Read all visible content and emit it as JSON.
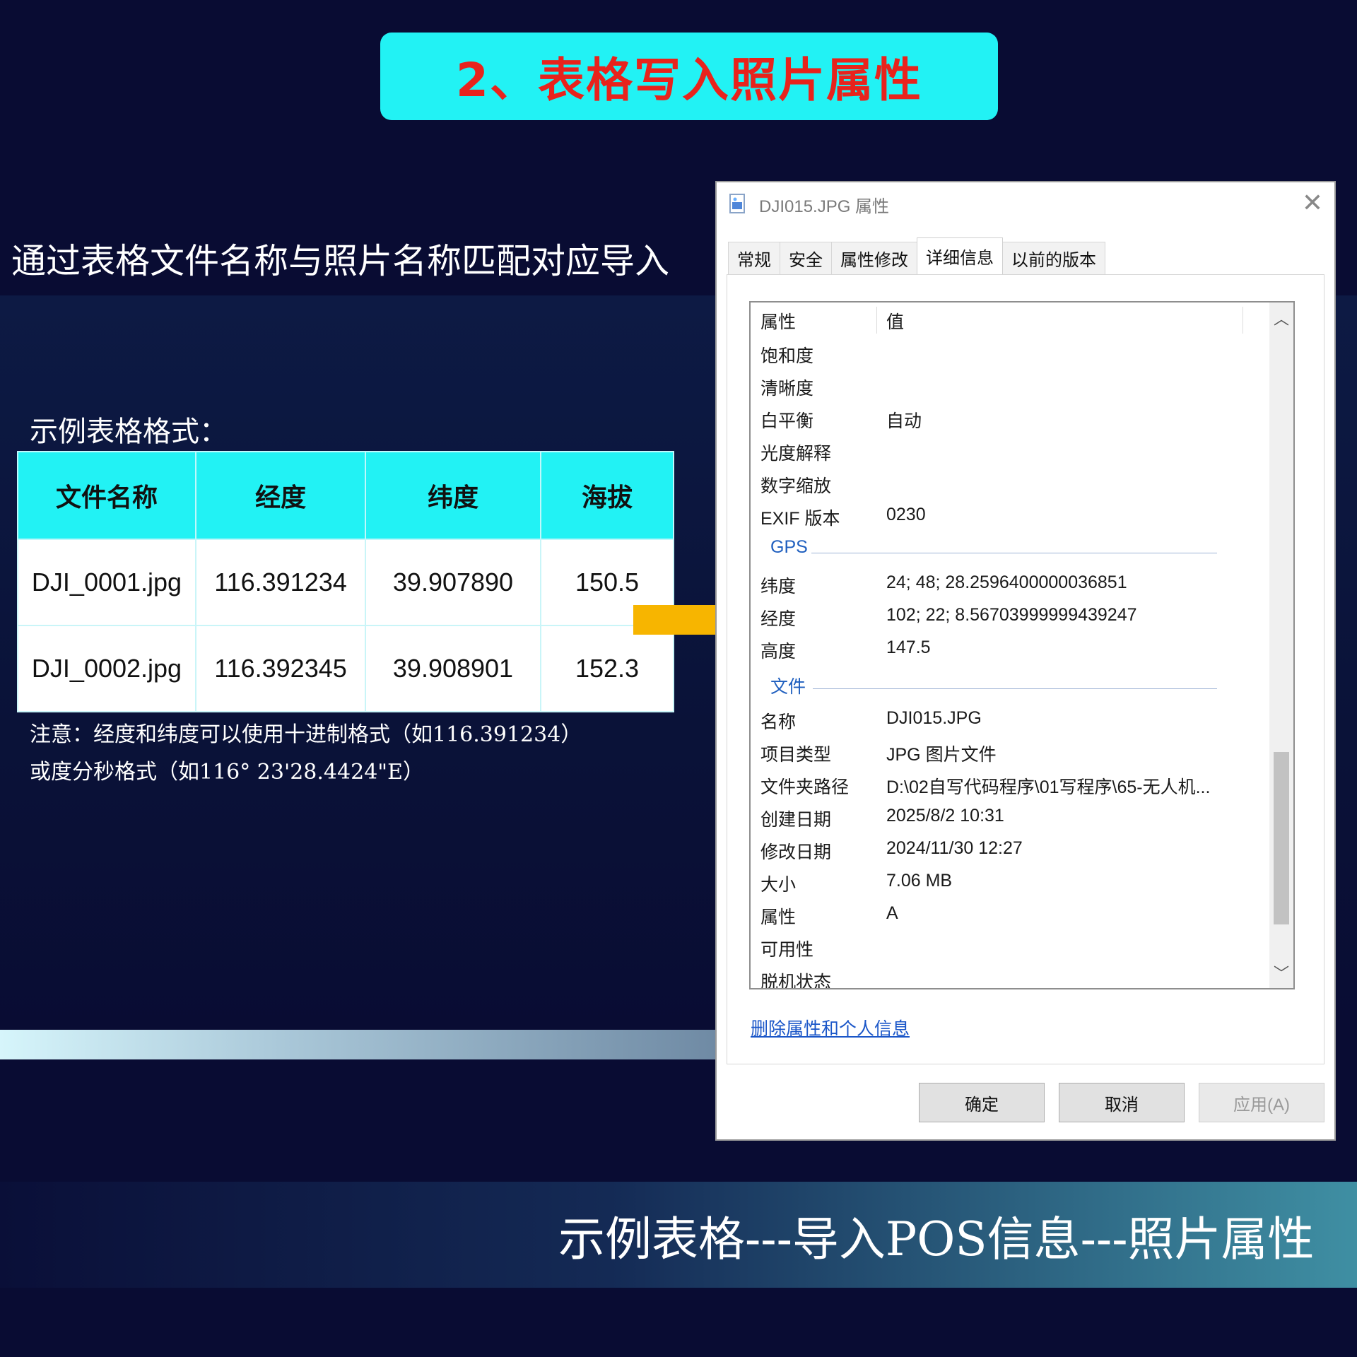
{
  "slide": {
    "title": "2、表格写入照片属性",
    "subtitle": "通过表格文件名称与照片名称匹配对应导入",
    "table_caption": "示例表格格式：",
    "table": {
      "headers": [
        "文件名称",
        "经度",
        "纬度",
        "海拔"
      ],
      "rows": [
        [
          "DJI_0001.jpg",
          "116.391234",
          "39.907890",
          "150.5"
        ],
        [
          "DJI_0002.jpg",
          "116.392345",
          "39.908901",
          "152.3"
        ]
      ]
    },
    "note_line1": "注意：经度和纬度可以使用十进制格式（如116.391234）",
    "note_line2": "或度分秒格式（如116°  23'28.4424\"E）",
    "bottom_text": "示例表格---导入POS信息---照片属性",
    "colors": {
      "title_bg": "#22f2f4",
      "title_text": "#e8231c",
      "background": "#090c33",
      "arrow": "#f7b500"
    }
  },
  "dialog": {
    "title": "DJI015.JPG 属性",
    "close_icon": "close-icon",
    "tabs": [
      "常规",
      "安全",
      "属性修改",
      "详细信息",
      "以前的版本"
    ],
    "active_tab": "详细信息",
    "columns": {
      "property": "属性",
      "value": "值"
    },
    "rows_top": [
      {
        "k": "饱和度",
        "v": ""
      },
      {
        "k": "清晰度",
        "v": ""
      },
      {
        "k": "白平衡",
        "v": "自动"
      },
      {
        "k": "光度解释",
        "v": ""
      },
      {
        "k": "数字缩放",
        "v": ""
      },
      {
        "k": "EXIF 版本",
        "v": "0230"
      }
    ],
    "group_gps": "GPS",
    "rows_gps": [
      {
        "k": "纬度",
        "v": "24; 48; 28.2596400000036851"
      },
      {
        "k": "经度",
        "v": "102; 22; 8.56703999999439247"
      },
      {
        "k": "高度",
        "v": "147.5"
      }
    ],
    "group_file": "文件",
    "rows_file": [
      {
        "k": "名称",
        "v": "DJI015.JPG"
      },
      {
        "k": "项目类型",
        "v": "JPG 图片文件"
      },
      {
        "k": "文件夹路径",
        "v": "D:\\02自写代码程序\\01写程序\\65-无人机..."
      },
      {
        "k": "创建日期",
        "v": "2025/8/2 10:31"
      },
      {
        "k": "修改日期",
        "v": "2024/11/30 12:27"
      },
      {
        "k": "大小",
        "v": "7.06 MB"
      },
      {
        "k": "属性",
        "v": "A"
      },
      {
        "k": "可用性",
        "v": ""
      },
      {
        "k": "脱机状态",
        "v": ""
      }
    ],
    "remove_link": "删除属性和个人信息",
    "buttons": {
      "ok": "确定",
      "cancel": "取消",
      "apply": "应用(A)"
    }
  }
}
